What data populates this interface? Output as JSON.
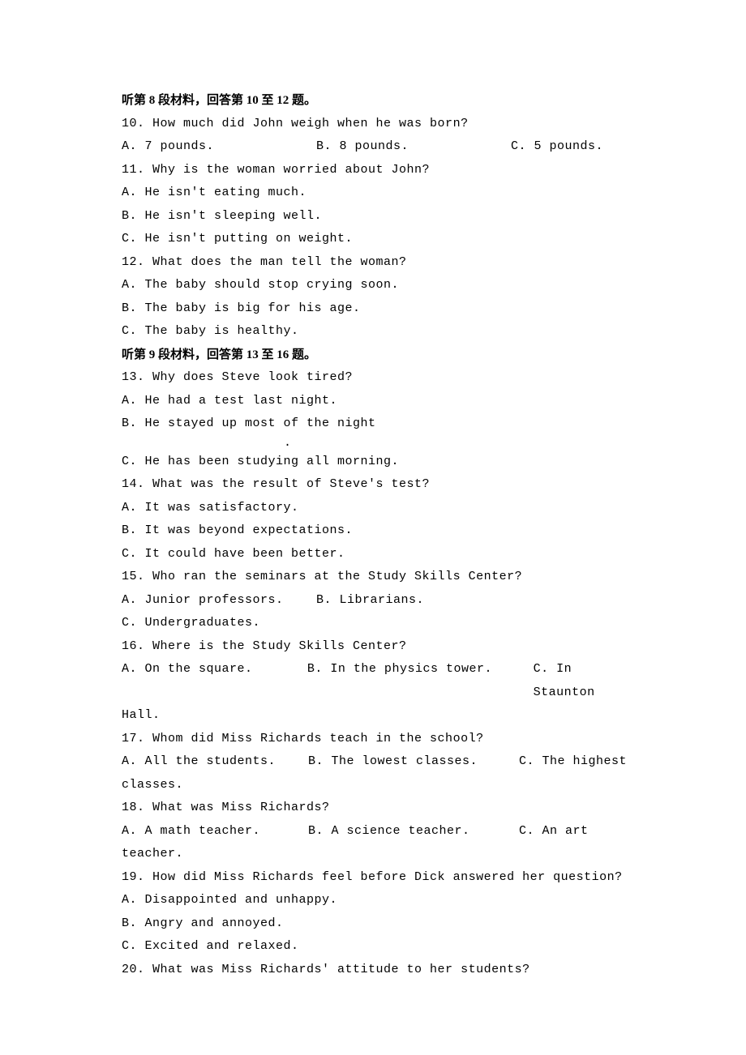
{
  "sections": {
    "s8": {
      "header": "听第 8 段材料，回答第 10 至 12 题。"
    },
    "s9": {
      "header": "听第 9 段材料，回答第 13 至 16 题。"
    }
  },
  "q10": {
    "text": "10. How much did John weigh when he was born?",
    "a": "A. 7 pounds.",
    "b": "B. 8 pounds.",
    "c": "C. 5 pounds."
  },
  "q11": {
    "text": "11. Why is the woman worried about John?",
    "a": "A. He isn't eating much.",
    "b": "B. He isn't sleeping well.",
    "c": "C. He isn't putting on weight."
  },
  "q12": {
    "text": "12. What does the man tell the woman?",
    "a": "A. The baby should stop crying soon.",
    "b": "B. The baby is big for his age.",
    "c": "C. The baby is healthy."
  },
  "q13": {
    "text": "13. Why does Steve look tired?",
    "a": "A. He had a test last night.",
    "b": "B. He stayed up most of the night",
    "b_sub": ".",
    "c": "C. He has been studying all morning."
  },
  "q14": {
    "text": "14. What was the result of Steve's test?",
    "a": "A. It was satisfactory.",
    "b": "B. It was beyond expectations.",
    "c": "C. It could have been better."
  },
  "q15": {
    "text": "15. Who ran the seminars at the Study Skills Center?",
    "a": "A. Junior professors.",
    "b": "B. Librarians.",
    "c": "C. Undergraduates."
  },
  "q16": {
    "text": "16. Where is the Study Skills Center?",
    "a": "A. On the square.",
    "b": "B. In the physics tower.",
    "c": "C. In Staunton",
    "c_cont": "Hall."
  },
  "q17": {
    "text": "17. Whom did Miss Richards teach in the school?",
    "a": "A. All the students.",
    "b": "B. The lowest classes.",
    "c": "C. The highest",
    "c_cont": "classes."
  },
  "q18": {
    "text": "18. What was Miss Richards?",
    "a": "A. A math teacher.",
    "b": "B. A science teacher.",
    "c": "C. An art",
    "c_cont": "teacher."
  },
  "q19": {
    "text": "19. How did Miss Richards feel before Dick answered her question?",
    "a": "A. Disappointed and unhappy.",
    "b": "B. Angry and annoyed.",
    "c": "C. Excited and relaxed."
  },
  "q20": {
    "text": "20. What was Miss Richards' attitude to her students?"
  }
}
